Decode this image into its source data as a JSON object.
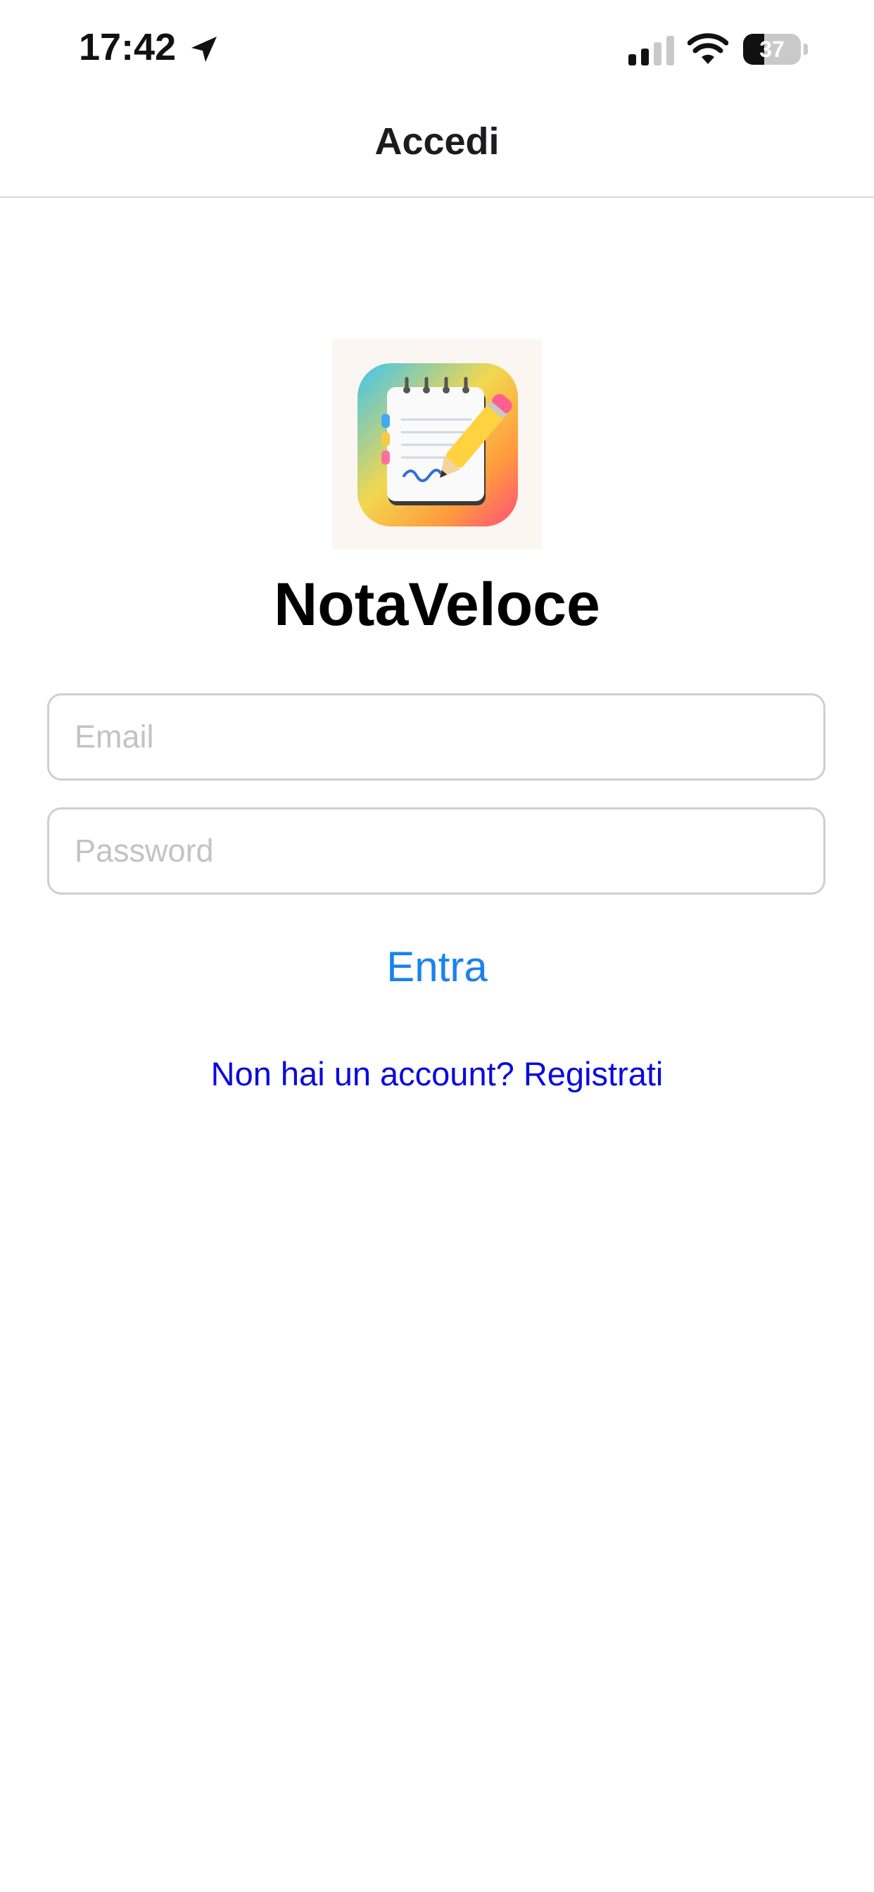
{
  "status_bar": {
    "time": "17:42",
    "battery": "37",
    "icons": [
      "location-arrow-icon",
      "cellular-signal-icon",
      "wifi-icon",
      "battery-icon"
    ]
  },
  "nav": {
    "title": "Accedi"
  },
  "app": {
    "name": "NotaVeloce",
    "logo_icon": "notepad-pencil-icon"
  },
  "form": {
    "email_placeholder": "Email",
    "email_value": "",
    "password_placeholder": "Password",
    "password_value": "",
    "login_label": "Entra"
  },
  "register": {
    "label": "Non hai un account? Registrati"
  },
  "colors": {
    "accent": "#1a82f0",
    "link": "#0a0adf",
    "field_border": "#cfcfcf",
    "placeholder": "#c2c2c7"
  }
}
